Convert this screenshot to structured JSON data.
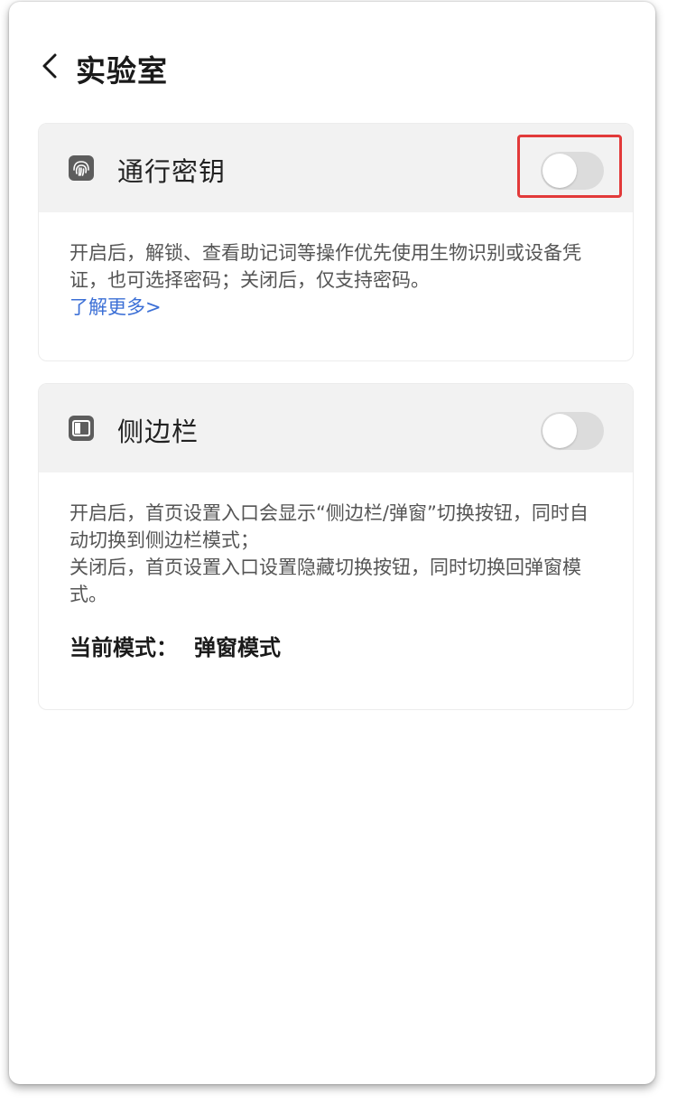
{
  "header": {
    "title": "实验室",
    "back_icon": "chevron-left-icon"
  },
  "passkey": {
    "title": "通行密钥",
    "icon": "fingerprint-icon",
    "toggle_on": false,
    "description": "开启后，解锁、查看助记词等操作优先使用生物识别或设备凭证，也可选择密码；关闭后，仅支持密码。",
    "learn_more": "了解更多>",
    "highlight_color": "#e23a3a"
  },
  "sidebar": {
    "title": "侧边栏",
    "icon": "sidebar-panel-icon",
    "toggle_on": false,
    "description_1": "开启后，首页设置入口会显示“侧边栏/弹窗”切换按钮，同时自动切换到侧边栏模式；",
    "description_2": "关闭后，首页设置入口设置隐藏切换按钮，同时切换回弹窗模式。",
    "current_mode_label": "当前模式：",
    "current_mode_value": "弹窗模式"
  },
  "colors": {
    "link": "#3b6fd6",
    "toggle_off_track": "#dcdcdc",
    "card_header_bg": "#f2f2f2"
  }
}
